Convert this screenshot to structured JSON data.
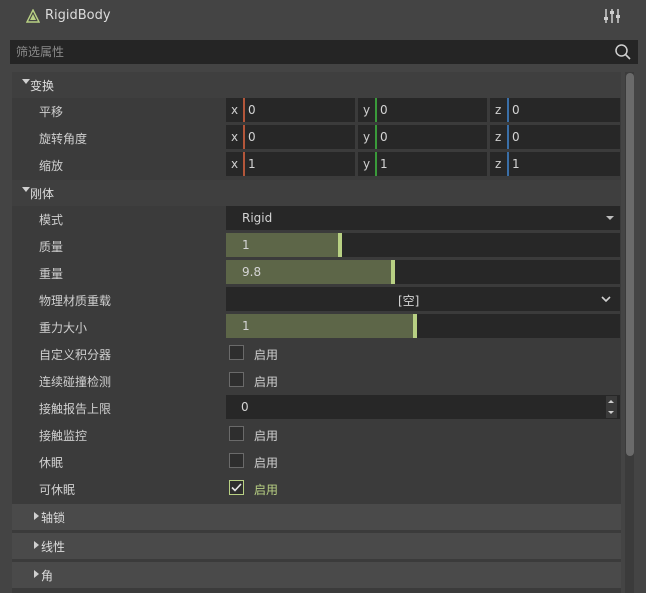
{
  "window": {
    "title": "RigidBody"
  },
  "search": {
    "placeholder": "筛选属性"
  },
  "transform": {
    "header": "变换",
    "position": {
      "label": "平移",
      "x": "0",
      "y": "0",
      "z": "0"
    },
    "rotation": {
      "label": "旋转角度",
      "x": "0",
      "y": "0",
      "z": "0"
    },
    "scale": {
      "label": "缩放",
      "x": "1",
      "y": "1",
      "z": "1"
    },
    "axis_labels": {
      "x": "x",
      "y": "y",
      "z": "z"
    },
    "axis_colors": {
      "x": "#b3563a",
      "y": "#3a9a3a",
      "z": "#3a6fa8"
    }
  },
  "rigidbody": {
    "header": "刚体",
    "mode": {
      "label": "模式",
      "value": "Rigid"
    },
    "mass": {
      "label": "质量",
      "value": "1",
      "fill_fraction": 0.29
    },
    "weight": {
      "label": "重量",
      "value": "9.8",
      "fill_fraction": 0.425
    },
    "physics_material": {
      "label": "物理材质重载",
      "value": "[空]"
    },
    "gravity_scale": {
      "label": "重力大小",
      "value": "1",
      "fill_fraction": 0.48
    },
    "custom_integrator": {
      "label": "自定义积分器",
      "text": "启用",
      "checked": false
    },
    "continuous_cd": {
      "label": "连续碰撞检测",
      "text": "启用",
      "checked": false
    },
    "max_contacts": {
      "label": "接触报告上限",
      "value": "0"
    },
    "contact_monitor": {
      "label": "接触监控",
      "text": "启用",
      "checked": false
    },
    "sleeping": {
      "label": "休眠",
      "text": "启用",
      "checked": false
    },
    "can_sleep": {
      "label": "可休眠",
      "text": "启用",
      "checked": true
    }
  },
  "collapsed": {
    "axis_lock": "轴锁",
    "linear": "线性",
    "angular": "角"
  },
  "colors": {
    "accent": "#b8d083",
    "slider_fill": "#5d6648"
  }
}
